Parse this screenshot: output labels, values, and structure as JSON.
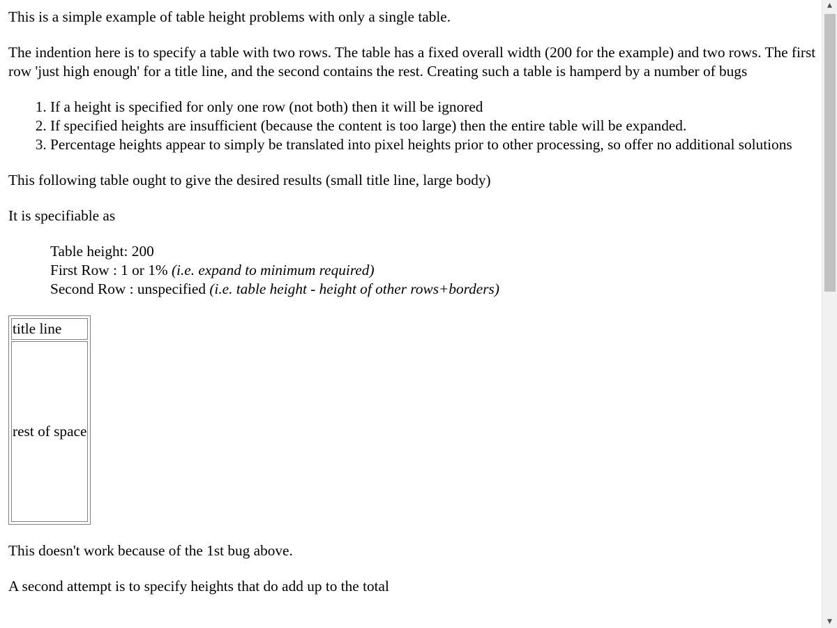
{
  "intro": "This is a simple example of table height problems with only a single table.",
  "description": "The indention here is to specify a table with two rows. The table has a fixed overall width (200 for the example) and two rows. The first row 'just high enough' for a title line, and the second contains the rest. Creating such a table is hamperd by a number of bugs",
  "bugs": [
    "If a height is specified for only one row (not both) then it will be ignored",
    "If specified heights are insufficient (because the content is too large) then the entire table will be expanded.",
    "Percentage heights appear to simply be translated into pixel heights prior to other processing, so offer no additional solutions"
  ],
  "desired_results": "This following table ought to give the desired results (small title line, large body)",
  "specifiable_as": "It is specifiable as",
  "spec": {
    "table_height": "Table height: 200",
    "first_row": "First Row : 1 or 1% ",
    "first_row_note": "(i.e. expand to minimum required)",
    "second_row": "Second Row : unspecified ",
    "second_row_note": "(i.e. table height - height of other rows+borders)"
  },
  "demo_table": {
    "title_cell": "title line",
    "body_cell": "rest of space"
  },
  "result_text": "This doesn't work because of the 1st bug above.",
  "second_attempt": "A second attempt is to specify heights that do add up to the total",
  "scrollbar": {
    "up_arrow": "▲",
    "down_arrow": "▼"
  }
}
